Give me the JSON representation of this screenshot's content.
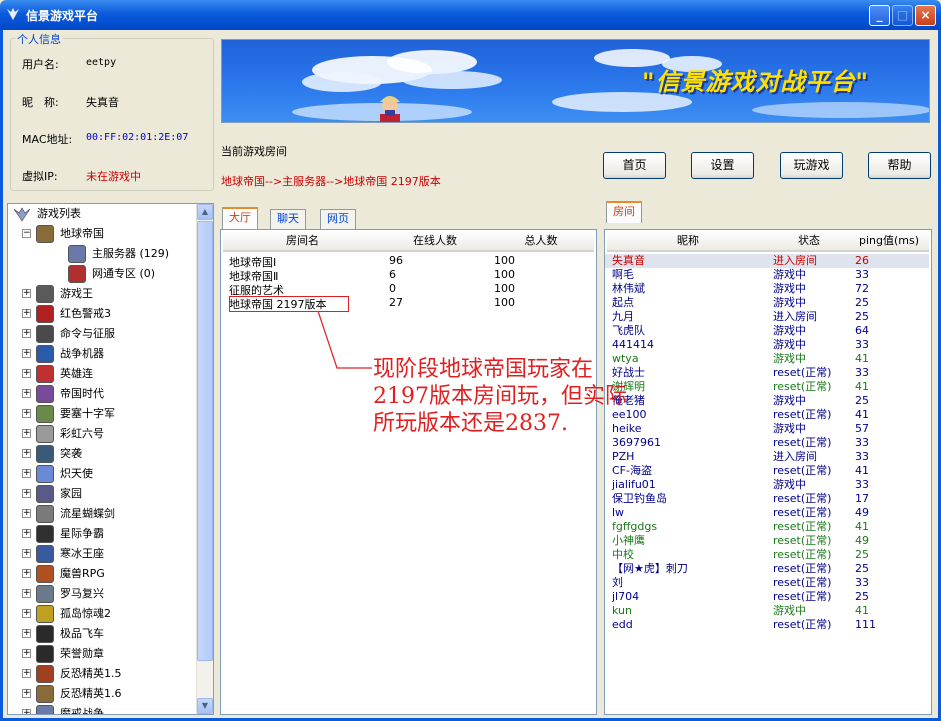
{
  "window": {
    "title": "信景游戏平台",
    "minimize": "_",
    "maximize": "□",
    "close": "×"
  },
  "info": {
    "legend": "个人信息",
    "username_label": "用户名:",
    "username": "eetpy",
    "nickname_label": "昵　称:",
    "nickname": "失真音",
    "mac_label": "MAC地址:",
    "mac": "00:FF:02:01:2E:07",
    "ip_label": "虚拟IP:",
    "ip": "未在游戏中"
  },
  "banner": {
    "text": "\"信景游戏对战平台\""
  },
  "current_room": {
    "label": "当前游戏房间",
    "path": "地球帝国-->主服务器-->地球帝国 2197版本"
  },
  "toolbar": {
    "home": "首页",
    "settings": "设置",
    "play": "玩游戏",
    "help": "帮助"
  },
  "tree": {
    "root": "游戏列表",
    "items": [
      {
        "label": "地球帝国",
        "icon": "earth-empire-icon",
        "expanded": true
      },
      {
        "label": "主服务器 (129)",
        "icon": "server-icon",
        "child": true
      },
      {
        "label": "网通专区 (0)",
        "icon": "server-icon",
        "child": true
      },
      {
        "label": "游戏王",
        "icon": "wings-icon"
      },
      {
        "label": "红色警戒3",
        "icon": "red-alert-icon"
      },
      {
        "label": "命令与征服",
        "icon": "cnc-icon"
      },
      {
        "label": "战争机器",
        "icon": "gears-icon"
      },
      {
        "label": "英雄连",
        "icon": "coh-icon"
      },
      {
        "label": "帝国时代",
        "icon": "aoe-icon"
      },
      {
        "label": "要塞十字军",
        "icon": "crusader-icon"
      },
      {
        "label": "彩虹六号",
        "icon": "rainbow-icon"
      },
      {
        "label": "突袭",
        "icon": "sudden-strike-icon"
      },
      {
        "label": "炽天使",
        "icon": "seraph-icon"
      },
      {
        "label": "家园",
        "icon": "homeworld-icon"
      },
      {
        "label": "流星蝴蝶剑",
        "icon": "butterfly-icon"
      },
      {
        "label": "星际争霸",
        "icon": "starcraft-icon"
      },
      {
        "label": "寒冰王座",
        "icon": "frozen-throne-icon"
      },
      {
        "label": "魔兽RPG",
        "icon": "rpg-icon"
      },
      {
        "label": "罗马复兴",
        "icon": "rome-icon"
      },
      {
        "label": "孤岛惊魂2",
        "icon": "farcry-icon"
      },
      {
        "label": "极品飞车",
        "icon": "nfs-icon"
      },
      {
        "label": "荣誉勋章",
        "icon": "moh-icon"
      },
      {
        "label": "反恐精英1.5",
        "icon": "cs-icon"
      },
      {
        "label": "反恐精英1.6",
        "icon": "cs-icon"
      },
      {
        "label": "魔戒战争",
        "icon": "lotr-icon"
      }
    ]
  },
  "tabs": {
    "lobby": "大厅",
    "chat": "聊天",
    "web": "网页",
    "room": "房间"
  },
  "rooms": {
    "headers": [
      "房间名",
      "在线人数",
      "总人数"
    ],
    "rows": [
      {
        "name": "地球帝国Ⅰ",
        "online": "96",
        "total": "100"
      },
      {
        "name": "地球帝国Ⅱ",
        "online": "6",
        "total": "100"
      },
      {
        "name": "征服的艺术",
        "online": "0",
        "total": "100"
      },
      {
        "name": "地球帝国 2197版本",
        "online": "27",
        "total": "100"
      }
    ]
  },
  "annotation": "现阶段地球帝国玩家在2197版本房间玩，但实际所玩版本还是2837.",
  "colors": {
    "status_red": "#cc0000",
    "status_green": "#1a7a1a",
    "name_blue": "#00008b"
  },
  "players": {
    "headers": [
      "昵称",
      "状态",
      "ping值(ms)"
    ],
    "rows": [
      {
        "name": "失真音",
        "status": "进入房间",
        "ping": "26",
        "color": "red"
      },
      {
        "name": "啊毛",
        "status": "游戏中",
        "ping": "33",
        "color": "blue"
      },
      {
        "name": "林伟斌",
        "status": "游戏中",
        "ping": "72",
        "color": "blue"
      },
      {
        "name": "起点",
        "status": "游戏中",
        "ping": "25",
        "color": "blue"
      },
      {
        "name": "九月",
        "status": "进入房间",
        "ping": "25",
        "color": "blue"
      },
      {
        "name": "飞虎队",
        "status": "游戏中",
        "ping": "64",
        "color": "blue"
      },
      {
        "name": "441414",
        "status": "游戏中",
        "ping": "33",
        "color": "blue"
      },
      {
        "name": "wtya",
        "status": "游戏中",
        "ping": "41",
        "color": "green"
      },
      {
        "name": "好战士",
        "status": "reset(正常)",
        "ping": "33",
        "color": "blue"
      },
      {
        "name": "谢辉明",
        "status": "reset(正常)",
        "ping": "41",
        "color": "green"
      },
      {
        "name": "俺老猪",
        "status": "游戏中",
        "ping": "25",
        "color": "blue"
      },
      {
        "name": "ee100",
        "status": "reset(正常)",
        "ping": "41",
        "color": "blue"
      },
      {
        "name": "heike",
        "status": "游戏中",
        "ping": "57",
        "color": "blue"
      },
      {
        "name": "3697961",
        "status": "reset(正常)",
        "ping": "33",
        "color": "blue"
      },
      {
        "name": "PZH",
        "status": "进入房间",
        "ping": "33",
        "color": "blue"
      },
      {
        "name": "CF-海盗",
        "status": "reset(正常)",
        "ping": "41",
        "color": "blue"
      },
      {
        "name": "jialifu01",
        "status": "游戏中",
        "ping": "33",
        "color": "blue"
      },
      {
        "name": "保卫钓鱼岛",
        "status": "reset(正常)",
        "ping": "17",
        "color": "blue"
      },
      {
        "name": "lw",
        "status": "reset(正常)",
        "ping": "49",
        "color": "blue"
      },
      {
        "name": "fgffgdgs",
        "status": "reset(正常)",
        "ping": "41",
        "color": "green"
      },
      {
        "name": "小神鹰",
        "status": "reset(正常)",
        "ping": "49",
        "color": "green"
      },
      {
        "name": "中校",
        "status": "reset(正常)",
        "ping": "25",
        "color": "green"
      },
      {
        "name": "【网★虎】刺刀",
        "status": "reset(正常)",
        "ping": "25",
        "color": "blue"
      },
      {
        "name": "刘",
        "status": "reset(正常)",
        "ping": "33",
        "color": "blue"
      },
      {
        "name": "jl704",
        "status": "reset(正常)",
        "ping": "25",
        "color": "blue"
      },
      {
        "name": "kun",
        "status": "游戏中",
        "ping": "41",
        "color": "green"
      },
      {
        "name": "edd",
        "status": "reset(正常)",
        "ping": "111",
        "color": "blue"
      }
    ]
  }
}
